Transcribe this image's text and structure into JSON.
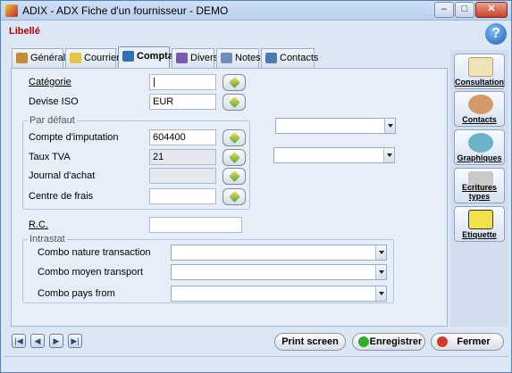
{
  "window": {
    "title": "ADIX - ADX  Fiche d'un fournisseur - DEMO",
    "minimize": "–",
    "maximize": "□",
    "close": "✕"
  },
  "header": {
    "libelle": "Libellé",
    "help": "?"
  },
  "tabs": [
    {
      "label": "Général",
      "icon": "general-icon",
      "color": "#c58b3a"
    },
    {
      "label": "Courrier",
      "icon": "mail-icon",
      "color": "#e5c24a"
    },
    {
      "label": "Compta",
      "icon": "accounting-icon",
      "color": "#2e6fb7"
    },
    {
      "label": "Divers",
      "icon": "people-icon",
      "color": "#7a5ab0"
    },
    {
      "label": "Notes",
      "icon": "notes-icon",
      "color": "#6f8fb8"
    },
    {
      "label": "Contacts",
      "icon": "contacts-icon",
      "color": "#4b7bb5"
    }
  ],
  "form": {
    "categorie_label": "Catégorie",
    "categorie_value": "|",
    "devise_label": "Devise ISO",
    "devise_value": "EUR",
    "par_defaut": "Par défaut",
    "compte_label": "Compte d'imputation",
    "compte_value": "604400",
    "taux_label": "Taux TVA",
    "taux_value": "21",
    "journal_label": "Journal d'achat",
    "journal_value": "",
    "centre_label": "Centre de frais",
    "centre_value": "",
    "rc_label": "R.C.",
    "rc_value": "",
    "intrastat": "Intrastat",
    "nature_label": "Combo nature transaction",
    "transport_label": "Combo moyen transport",
    "pays_label": "Combo pays from"
  },
  "sidebar": [
    {
      "label": "Consultation",
      "icon": "book-icon",
      "color": "#efe3b8"
    },
    {
      "label": "Contacts",
      "icon": "person-icon",
      "color": "#d49a6a"
    },
    {
      "label": "Graphiques",
      "icon": "pie-chart-icon",
      "color": "#6ab3c9"
    },
    {
      "label": "Ecritures types",
      "icon": "pen-icon",
      "color": "#c9c9c9"
    },
    {
      "label": "Etiquette",
      "icon": "label-icon",
      "color": "#f3e04a"
    }
  ],
  "footer": {
    "print": "Print screen",
    "save": "Enregistrer",
    "close": "Fermer",
    "save_color": "#2fae2f",
    "close_color": "#d23a2a",
    "nav": [
      "|◀",
      "◀",
      "▶",
      "▶|"
    ]
  }
}
